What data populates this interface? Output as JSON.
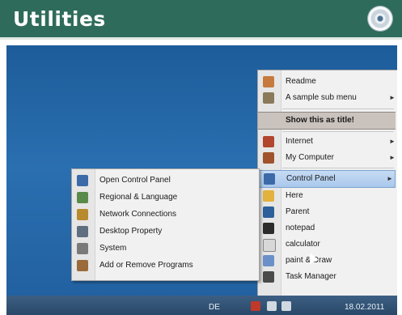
{
  "header": {
    "title": "Utilities",
    "accent": "#2f6b5a",
    "icon": "cd-disc-icon"
  },
  "right_menu": {
    "items": [
      {
        "label": "Readme",
        "icon": "document-icon",
        "submenu": false
      },
      {
        "label": "A sample sub menu",
        "icon": "folder-icon",
        "submenu": true
      },
      {
        "label": "Show this as title!",
        "icon": "",
        "submenu": false
      },
      {
        "label": "Internet",
        "icon": "globe-icon",
        "submenu": true
      },
      {
        "label": "My Computer",
        "icon": "computer-icon",
        "submenu": true
      },
      {
        "label": "Control Panel",
        "icon": "control-panel-icon",
        "submenu": true
      },
      {
        "label": "Here",
        "icon": "folder-icon",
        "submenu": false
      },
      {
        "label": "Parent",
        "icon": "folder-up-icon",
        "submenu": false
      },
      {
        "label": "notepad",
        "icon": "notepad-icon",
        "submenu": false
      },
      {
        "label": "calculator",
        "icon": "calculator-icon",
        "submenu": false
      },
      {
        "label": "paint & Draw",
        "icon": "paint-icon",
        "submenu": false
      },
      {
        "label": "Task Manager",
        "icon": "task-manager-icon",
        "submenu": false
      }
    ]
  },
  "left_menu": {
    "items": [
      {
        "label": "Open Control Panel",
        "icon": "control-panel-icon"
      },
      {
        "label": "Regional & Language",
        "icon": "globe-icon"
      },
      {
        "label": "Network Connections",
        "icon": "network-icon"
      },
      {
        "label": "Desktop Property",
        "icon": "desktop-icon"
      },
      {
        "label": "System",
        "icon": "system-icon"
      },
      {
        "label": "Add or Remove Programs",
        "icon": "programs-icon"
      }
    ]
  },
  "taskbar": {
    "language": "DE",
    "date": "18.02.2011"
  }
}
